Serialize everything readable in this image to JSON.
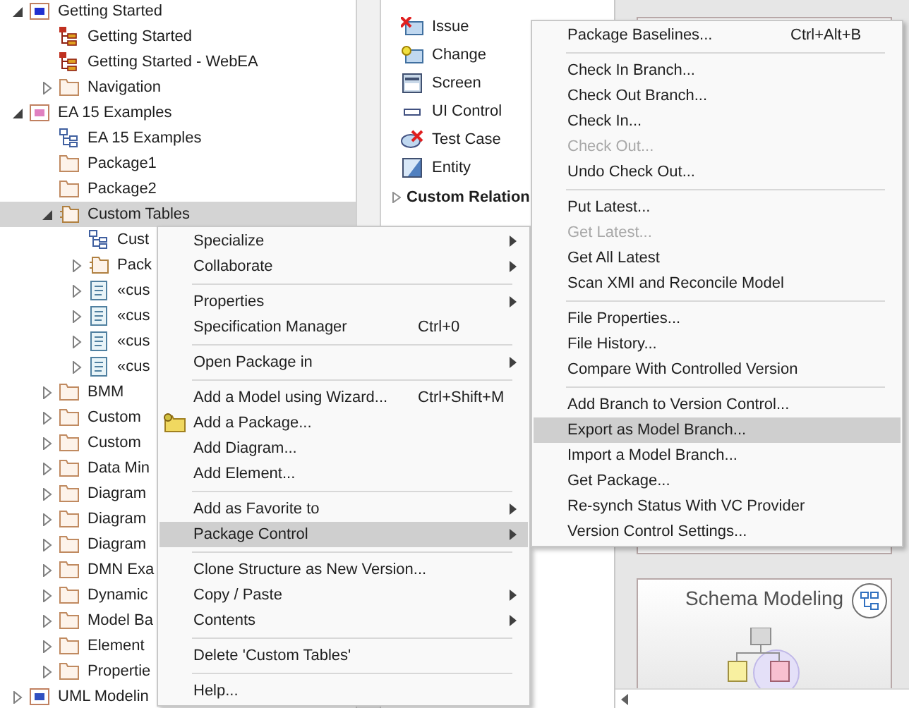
{
  "tree": [
    {
      "label": "Getting Started",
      "kind": "model",
      "color": "#2030d0",
      "expanded": true,
      "selected": false,
      "children": [
        {
          "label": "Getting Started",
          "kind": "diagram-tree",
          "selected": false
        },
        {
          "label": "Getting Started - WebEA",
          "kind": "diagram-tree",
          "selected": false
        },
        {
          "label": "Navigation",
          "kind": "package",
          "expanded": false,
          "selected": false
        }
      ]
    },
    {
      "label": "EA 15 Examples",
      "kind": "model",
      "color": "#e080c0",
      "expanded": true,
      "selected": false,
      "children": [
        {
          "label": "EA 15 Examples",
          "kind": "diagram",
          "selected": false
        },
        {
          "label": "Package1",
          "kind": "package",
          "selected": false
        },
        {
          "label": "Package2",
          "kind": "package",
          "selected": false
        },
        {
          "label": "Custom Tables",
          "kind": "package-link",
          "expanded": true,
          "selected": true,
          "children": [
            {
              "label": "Cust",
              "kind": "diagram",
              "selected": false
            },
            {
              "label": "Pack",
              "kind": "package-link",
              "expanded": false,
              "selected": false
            },
            {
              "label": "«cus",
              "kind": "document",
              "expanded": false,
              "selected": false
            },
            {
              "label": "«cus",
              "kind": "document",
              "expanded": false,
              "selected": false
            },
            {
              "label": "«cus",
              "kind": "document",
              "expanded": false,
              "selected": false
            },
            {
              "label": "«cus",
              "kind": "document",
              "expanded": false,
              "selected": false
            }
          ]
        },
        {
          "label": "BMM",
          "kind": "package",
          "expanded": false,
          "selected": false
        },
        {
          "label": "Custom",
          "kind": "package",
          "expanded": false,
          "selected": false
        },
        {
          "label": "Custom",
          "kind": "package",
          "expanded": false,
          "selected": false
        },
        {
          "label": "Data Min",
          "kind": "package",
          "expanded": false,
          "selected": false
        },
        {
          "label": "Diagram",
          "kind": "package",
          "expanded": false,
          "selected": false
        },
        {
          "label": "Diagram",
          "kind": "package",
          "expanded": false,
          "selected": false
        },
        {
          "label": "Diagram",
          "kind": "package",
          "expanded": false,
          "selected": false
        },
        {
          "label": "DMN Exa",
          "kind": "package",
          "expanded": false,
          "selected": false
        },
        {
          "label": "Dynamic",
          "kind": "package",
          "expanded": false,
          "selected": false
        },
        {
          "label": "Model Ba",
          "kind": "package",
          "expanded": false,
          "selected": false
        },
        {
          "label": "Element",
          "kind": "package",
          "expanded": false,
          "selected": false
        },
        {
          "label": "Propertie",
          "kind": "package",
          "expanded": false,
          "selected": false
        }
      ]
    },
    {
      "label": "UML Modelin",
      "kind": "model",
      "color": "#3050c0",
      "expanded": false,
      "selected": false
    }
  ],
  "toolbox": {
    "items": [
      {
        "label": "Issue",
        "kind": "issue"
      },
      {
        "label": "Change",
        "kind": "change"
      },
      {
        "label": "Screen",
        "kind": "screen"
      },
      {
        "label": "UI Control",
        "kind": "ui-control"
      },
      {
        "label": "Test Case",
        "kind": "test-case"
      },
      {
        "label": "Entity",
        "kind": "entity"
      }
    ],
    "section": {
      "label": "Custom Relation",
      "expanded": false
    }
  },
  "cards": [
    {
      "title": "Schema Modeling"
    }
  ],
  "context_menu": [
    {
      "kind": "item",
      "label": "Specialize",
      "submenu": true,
      "selected": false
    },
    {
      "kind": "item",
      "label": "Collaborate",
      "submenu": true,
      "selected": false
    },
    {
      "kind": "separator"
    },
    {
      "kind": "item",
      "label": "Properties",
      "submenu": true,
      "selected": false
    },
    {
      "kind": "item",
      "label": "Specification Manager",
      "shortcut": "Ctrl+0",
      "selected": false
    },
    {
      "kind": "separator"
    },
    {
      "kind": "item",
      "label": "Open Package in",
      "submenu": true,
      "selected": false
    },
    {
      "kind": "separator"
    },
    {
      "kind": "item",
      "label": "Add a Model using Wizard...",
      "shortcut": "Ctrl+Shift+M",
      "selected": false
    },
    {
      "kind": "icon-item",
      "label": "Add a Package...",
      "selected": false
    },
    {
      "kind": "item",
      "label": "Add Diagram...",
      "selected": false
    },
    {
      "kind": "item",
      "label": "Add Element...",
      "selected": false
    },
    {
      "kind": "separator"
    },
    {
      "kind": "item",
      "label": "Add as Favorite to",
      "submenu": true,
      "selected": false
    },
    {
      "kind": "item",
      "label": "Package Control",
      "submenu": true,
      "selected": true
    },
    {
      "kind": "separator"
    },
    {
      "kind": "item",
      "label": "Clone Structure as New Version...",
      "selected": false
    },
    {
      "kind": "item",
      "label": "Copy / Paste",
      "submenu": true,
      "selected": false
    },
    {
      "kind": "item",
      "label": "Contents",
      "submenu": true,
      "selected": false
    },
    {
      "kind": "separator"
    },
    {
      "kind": "item",
      "label": "Delete 'Custom Tables'",
      "selected": false
    },
    {
      "kind": "separator"
    },
    {
      "kind": "item",
      "label": "Help...",
      "selected": false
    }
  ],
  "submenu": [
    {
      "kind": "item",
      "label": "Package Baselines...",
      "shortcut": "Ctrl+Alt+B",
      "disabled": false,
      "selected": false
    },
    {
      "kind": "separator"
    },
    {
      "kind": "item",
      "label": "Check In Branch...",
      "disabled": false,
      "selected": false
    },
    {
      "kind": "item",
      "label": "Check Out Branch...",
      "disabled": false,
      "selected": false
    },
    {
      "kind": "item",
      "label": "Check In...",
      "disabled": false,
      "selected": false
    },
    {
      "kind": "item",
      "label": "Check Out...",
      "disabled": true,
      "selected": false
    },
    {
      "kind": "item",
      "label": "Undo Check Out...",
      "disabled": false,
      "selected": false
    },
    {
      "kind": "separator"
    },
    {
      "kind": "item",
      "label": "Put Latest...",
      "disabled": false,
      "selected": false
    },
    {
      "kind": "item",
      "label": "Get Latest...",
      "disabled": true,
      "selected": false
    },
    {
      "kind": "item",
      "label": "Get All Latest",
      "disabled": false,
      "selected": false
    },
    {
      "kind": "item",
      "label": "Scan XMI and Reconcile Model",
      "disabled": false,
      "selected": false
    },
    {
      "kind": "separator"
    },
    {
      "kind": "item",
      "label": "File Properties...",
      "disabled": false,
      "selected": false
    },
    {
      "kind": "item",
      "label": "File History...",
      "disabled": false,
      "selected": false
    },
    {
      "kind": "item",
      "label": "Compare With Controlled Version",
      "disabled": false,
      "selected": false
    },
    {
      "kind": "separator"
    },
    {
      "kind": "item",
      "label": "Add Branch to Version Control...",
      "disabled": false,
      "selected": false
    },
    {
      "kind": "item",
      "label": "Export as Model Branch...",
      "disabled": false,
      "selected": true
    },
    {
      "kind": "item",
      "label": "Import a Model Branch...",
      "disabled": false,
      "selected": false
    },
    {
      "kind": "item",
      "label": "Get Package...",
      "disabled": false,
      "selected": false
    },
    {
      "kind": "item",
      "label": "Re-synch Status With VC Provider",
      "disabled": false,
      "selected": false
    },
    {
      "kind": "item",
      "label": "Version Control Settings...",
      "disabled": false,
      "selected": false
    }
  ]
}
